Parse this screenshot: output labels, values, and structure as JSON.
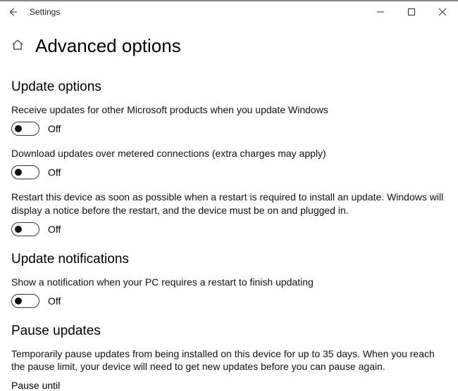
{
  "titlebar": {
    "title": "Settings"
  },
  "header": {
    "title": "Advanced options"
  },
  "sections": {
    "update_options": {
      "title": "Update options",
      "item1": {
        "desc": "Receive updates for other Microsoft products when you update Windows",
        "state": "Off"
      },
      "item2": {
        "desc": "Download updates over metered connections (extra charges may apply)",
        "state": "Off"
      },
      "item3": {
        "desc": "Restart this device as soon as possible when a restart is required to install an update. Windows will display a notice before the restart, and the device must be on and plugged in.",
        "state": "Off"
      }
    },
    "update_notifications": {
      "title": "Update notifications",
      "item1": {
        "desc": "Show a notification when your PC requires a restart to finish updating",
        "state": "Off"
      }
    },
    "pause_updates": {
      "title": "Pause updates",
      "desc": "Temporarily pause updates from being installed on this device for up to 35 days. When you reach the pause limit, your device will need to get new updates before you can pause again.",
      "label": "Pause until"
    }
  }
}
